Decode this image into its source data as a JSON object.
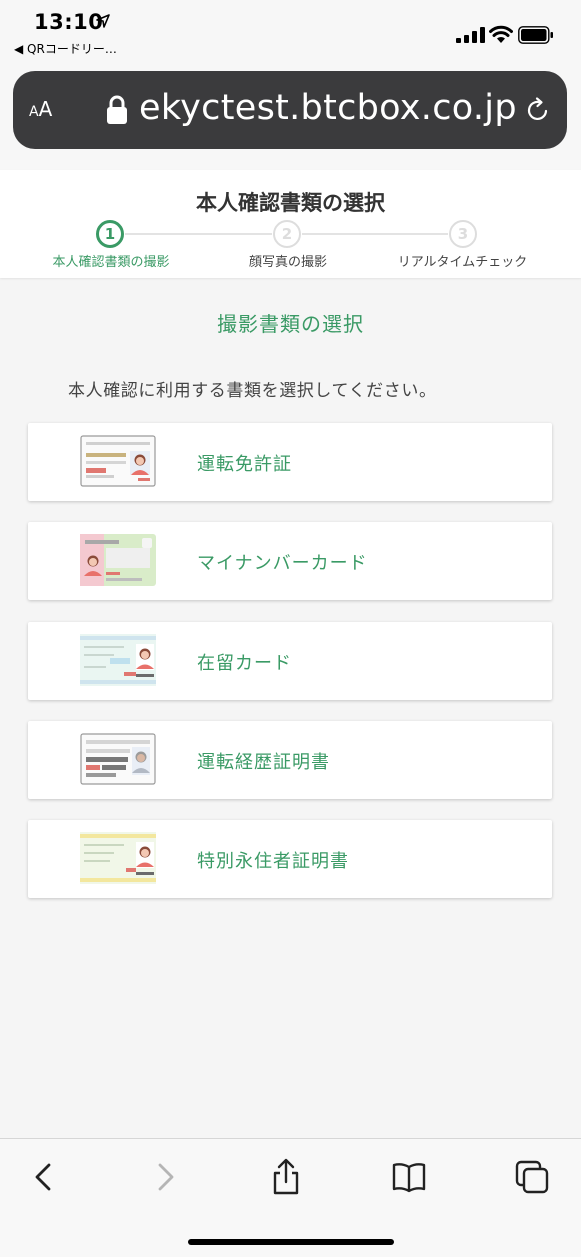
{
  "status_bar": {
    "time": "13:10",
    "back_app": "◀ QRコードリー…"
  },
  "safari": {
    "text_size_label": "AA",
    "url": "ekyctest.btcbox.co.jp"
  },
  "header": {
    "title": "本人確認書類の選択",
    "steps": [
      {
        "number": "1",
        "label": "本人確認書類の撮影",
        "active": true
      },
      {
        "number": "2",
        "label": "顔写真の撮影",
        "active": false
      },
      {
        "number": "3",
        "label": "リアルタイムチェック",
        "active": false
      }
    ]
  },
  "main": {
    "section_title": "撮影書類の選択",
    "instruction": "本人確認に利用する書類を選択してください。",
    "documents": [
      {
        "label": "運転免許証",
        "icon": "drivers-license-icon"
      },
      {
        "label": "マイナンバーカード",
        "icon": "my-number-card-icon"
      },
      {
        "label": "在留カード",
        "icon": "residence-card-icon"
      },
      {
        "label": "運転経歴証明書",
        "icon": "driving-history-certificate-icon"
      },
      {
        "label": "特別永住者証明書",
        "icon": "special-permanent-resident-certificate-icon"
      }
    ]
  },
  "toolbar": {
    "buttons": [
      "back-icon",
      "forward-icon",
      "share-icon",
      "bookmarks-icon",
      "tabs-icon"
    ]
  },
  "colors": {
    "accent": "#3a9a65",
    "url_bar": "#3b3b3d",
    "background": "#f5f5f5"
  }
}
